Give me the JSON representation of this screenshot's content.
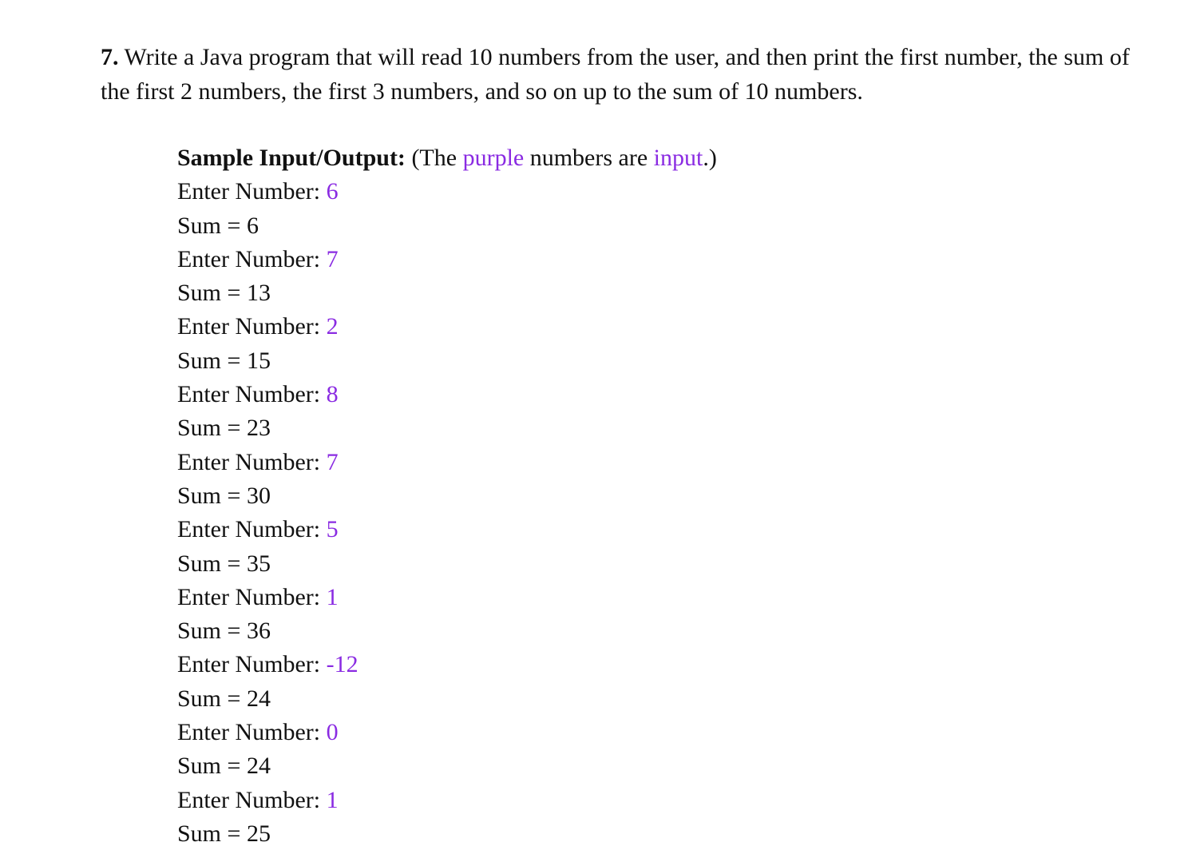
{
  "question": {
    "number": "7.",
    "text": "Write a Java program that will read 10 numbers from the user, and then print the first number, the sum of the first 2 numbers, the first 3 numbers, and so on up to the sum of 10 numbers."
  },
  "sample": {
    "heading": "Sample Input/Output:",
    "note_open": " (The ",
    "note_purple_word": "purple",
    "note_middle": " numbers are ",
    "note_input_word": "input",
    "note_close": ".)",
    "prompt_label": "Enter Number: ",
    "sum_label": "Sum = ",
    "rows": [
      {
        "input": "6",
        "sum": "6"
      },
      {
        "input": "7",
        "sum": "13"
      },
      {
        "input": "2",
        "sum": "15"
      },
      {
        "input": "8",
        "sum": "23"
      },
      {
        "input": "7",
        "sum": "30"
      },
      {
        "input": "5",
        "sum": "35"
      },
      {
        "input": "1",
        "sum": "36"
      },
      {
        "input": "-12",
        "sum": "24"
      },
      {
        "input": "0",
        "sum": "24"
      },
      {
        "input": "1",
        "sum": "25"
      }
    ]
  },
  "colors": {
    "input_color": "#8a2be2",
    "text_color": "#111111"
  }
}
